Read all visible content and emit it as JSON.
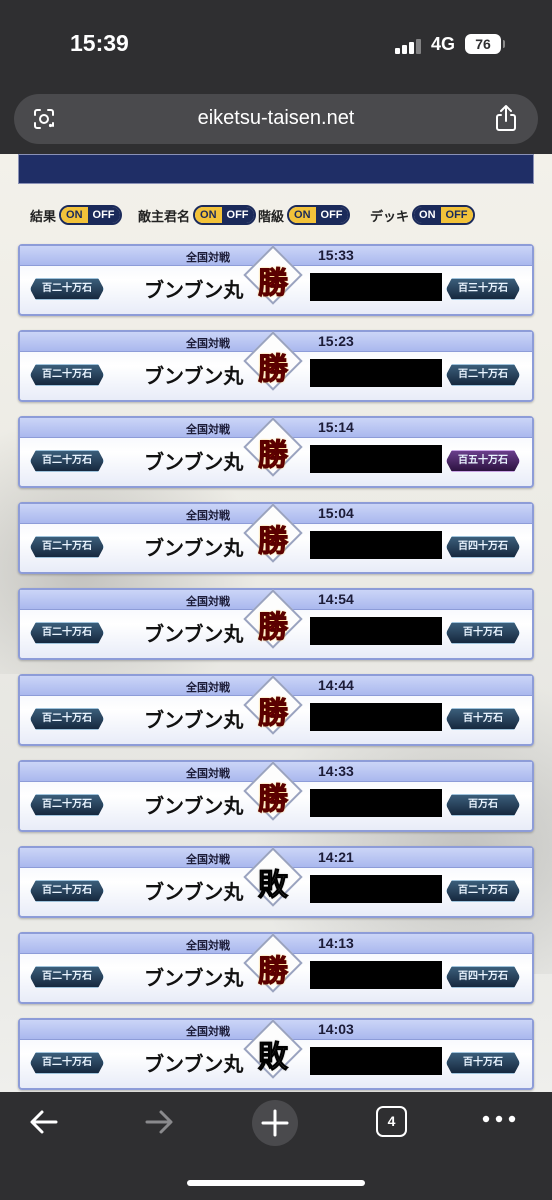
{
  "status_bar": {
    "time": "15:39",
    "network": "4G",
    "battery": "76"
  },
  "browser": {
    "url": "eiketsu-taisen.net",
    "tab_count": "4"
  },
  "filters": [
    {
      "label": "結果",
      "on": "ON",
      "off": "OFF",
      "active": "on"
    },
    {
      "label": "敵主君名",
      "on": "ON",
      "off": "OFF",
      "active": "on"
    },
    {
      "label": "階級",
      "on": "ON",
      "off": "OFF",
      "active": "on"
    },
    {
      "label": "デッキ",
      "on": "ON",
      "off": "OFF",
      "active": "off"
    }
  ],
  "records": [
    {
      "match_type": "全国対戦",
      "time": "15:33",
      "player": "ブンブン丸",
      "result": "勝",
      "outcome": "win",
      "player_rank": "百二十万石",
      "opponent_rank": "百三十万石",
      "opponent_rank_color": "blue"
    },
    {
      "match_type": "全国対戦",
      "time": "15:23",
      "player": "ブンブン丸",
      "result": "勝",
      "outcome": "win",
      "player_rank": "百二十万石",
      "opponent_rank": "百二十万石",
      "opponent_rank_color": "blue"
    },
    {
      "match_type": "全国対戦",
      "time": "15:14",
      "player": "ブンブン丸",
      "result": "勝",
      "outcome": "win",
      "player_rank": "百二十万石",
      "opponent_rank": "百五十万石",
      "opponent_rank_color": "purple"
    },
    {
      "match_type": "全国対戦",
      "time": "15:04",
      "player": "ブンブン丸",
      "result": "勝",
      "outcome": "win",
      "player_rank": "百二十万石",
      "opponent_rank": "百四十万石",
      "opponent_rank_color": "blue"
    },
    {
      "match_type": "全国対戦",
      "time": "14:54",
      "player": "ブンブン丸",
      "result": "勝",
      "outcome": "win",
      "player_rank": "百二十万石",
      "opponent_rank": "百十万石",
      "opponent_rank_color": "blue"
    },
    {
      "match_type": "全国対戦",
      "time": "14:44",
      "player": "ブンブン丸",
      "result": "勝",
      "outcome": "win",
      "player_rank": "百二十万石",
      "opponent_rank": "百十万石",
      "opponent_rank_color": "blue"
    },
    {
      "match_type": "全国対戦",
      "time": "14:33",
      "player": "ブンブン丸",
      "result": "勝",
      "outcome": "win",
      "player_rank": "百二十万石",
      "opponent_rank": "百万石",
      "opponent_rank_color": "blue"
    },
    {
      "match_type": "全国対戦",
      "time": "14:21",
      "player": "ブンブン丸",
      "result": "敗",
      "outcome": "lose",
      "player_rank": "百二十万石",
      "opponent_rank": "百二十万石",
      "opponent_rank_color": "blue"
    },
    {
      "match_type": "全国対戦",
      "time": "14:13",
      "player": "ブンブン丸",
      "result": "勝",
      "outcome": "win",
      "player_rank": "百二十万石",
      "opponent_rank": "百四十万石",
      "opponent_rank_color": "blue"
    },
    {
      "match_type": "全国対戦",
      "time": "14:03",
      "player": "ブンブン丸",
      "result": "敗",
      "outcome": "lose",
      "player_rank": "百二十万石",
      "opponent_rank": "百十万石",
      "opponent_rank_color": "blue"
    }
  ],
  "colors": {
    "win": "#d81b12",
    "lose": "#3a3a3a",
    "toggle_active": "#f2c23a",
    "toggle_inactive": "#1b2a5a",
    "header_banner": "#1f2e66"
  }
}
